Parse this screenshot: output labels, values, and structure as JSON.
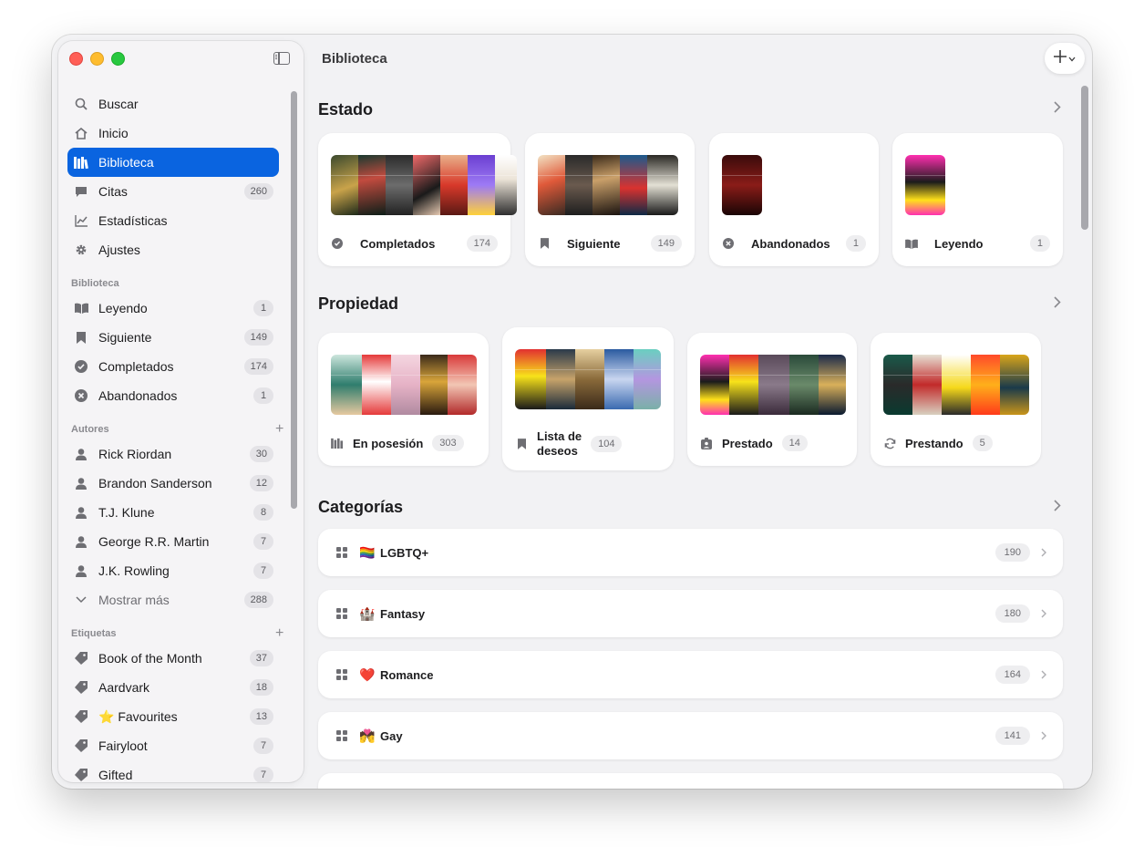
{
  "window_title": "Biblioteca",
  "sidebar": {
    "nav": [
      {
        "label": "Buscar",
        "icon": "search-icon",
        "count": ""
      },
      {
        "label": "Inicio",
        "icon": "home-icon",
        "count": ""
      },
      {
        "label": "Biblioteca",
        "icon": "library-icon",
        "count": "",
        "active": true
      },
      {
        "label": "Citas",
        "icon": "quote-bubble-icon",
        "count": "260"
      },
      {
        "label": "Estadísticas",
        "icon": "chart-line-icon",
        "count": ""
      },
      {
        "label": "Ajustes",
        "icon": "gear-icon",
        "count": ""
      }
    ],
    "library_header": "Biblioteca",
    "library": [
      {
        "label": "Leyendo",
        "icon": "open-book-icon",
        "count": "1"
      },
      {
        "label": "Siguiente",
        "icon": "bookmark-icon",
        "count": "149"
      },
      {
        "label": "Completados",
        "icon": "checkmark-circle-icon",
        "count": "174"
      },
      {
        "label": "Abandonados",
        "icon": "xmark-circle-icon",
        "count": "1"
      }
    ],
    "authors_header": "Autores",
    "authors": [
      {
        "label": "Rick Riordan",
        "count": "30"
      },
      {
        "label": "Brandon Sanderson",
        "count": "12"
      },
      {
        "label": "T.J. Klune",
        "count": "8"
      },
      {
        "label": "George R.R. Martin",
        "count": "7"
      },
      {
        "label": "J.K. Rowling",
        "count": "7"
      }
    ],
    "show_more": {
      "label": "Mostrar más",
      "count": "288"
    },
    "tags_header": "Etiquetas",
    "tags": [
      {
        "label": "Book of the Month",
        "count": "37"
      },
      {
        "label": "Aardvark",
        "count": "18"
      },
      {
        "label": "⭐ Favourites",
        "count": "13"
      },
      {
        "label": "Fairyloot",
        "count": "7"
      },
      {
        "label": "Gifted",
        "count": "7"
      }
    ]
  },
  "estado": {
    "title": "Estado",
    "cards": [
      {
        "label": "Completados",
        "count": "174",
        "icon": "checkmark-circle-icon"
      },
      {
        "label": "Siguiente",
        "count": "149",
        "icon": "bookmark-icon"
      },
      {
        "label": "Abandonados",
        "count": "1",
        "icon": "xmark-circle-icon"
      },
      {
        "label": "Leyendo",
        "count": "1",
        "icon": "open-book-icon"
      }
    ]
  },
  "propiedad": {
    "title": "Propiedad",
    "cards": [
      {
        "label": "En posesión",
        "count": "303",
        "icon": "library-icon"
      },
      {
        "label_line1": "Lista de",
        "label_line2": "deseos",
        "count": "104",
        "icon": "bookmark-icon"
      },
      {
        "label": "Prestado",
        "count": "14",
        "icon": "person-badge-icon"
      },
      {
        "label": "Prestando",
        "count": "5",
        "icon": "arrows-circle-icon"
      }
    ]
  },
  "categorias": {
    "title": "Categorías",
    "rows": [
      {
        "emoji": "🏳️‍🌈",
        "label": "LGBTQ+",
        "count": "190"
      },
      {
        "emoji": "🏰",
        "label": "Fantasy",
        "count": "180"
      },
      {
        "emoji": "❤️",
        "label": "Romance",
        "count": "164"
      },
      {
        "emoji": "💏",
        "label": "Gay",
        "count": "141"
      }
    ]
  },
  "colors": {
    "accent": "#0a64e0",
    "window_bg": "#f2f2f4",
    "sidebar_bg": "#f5f4f6"
  }
}
